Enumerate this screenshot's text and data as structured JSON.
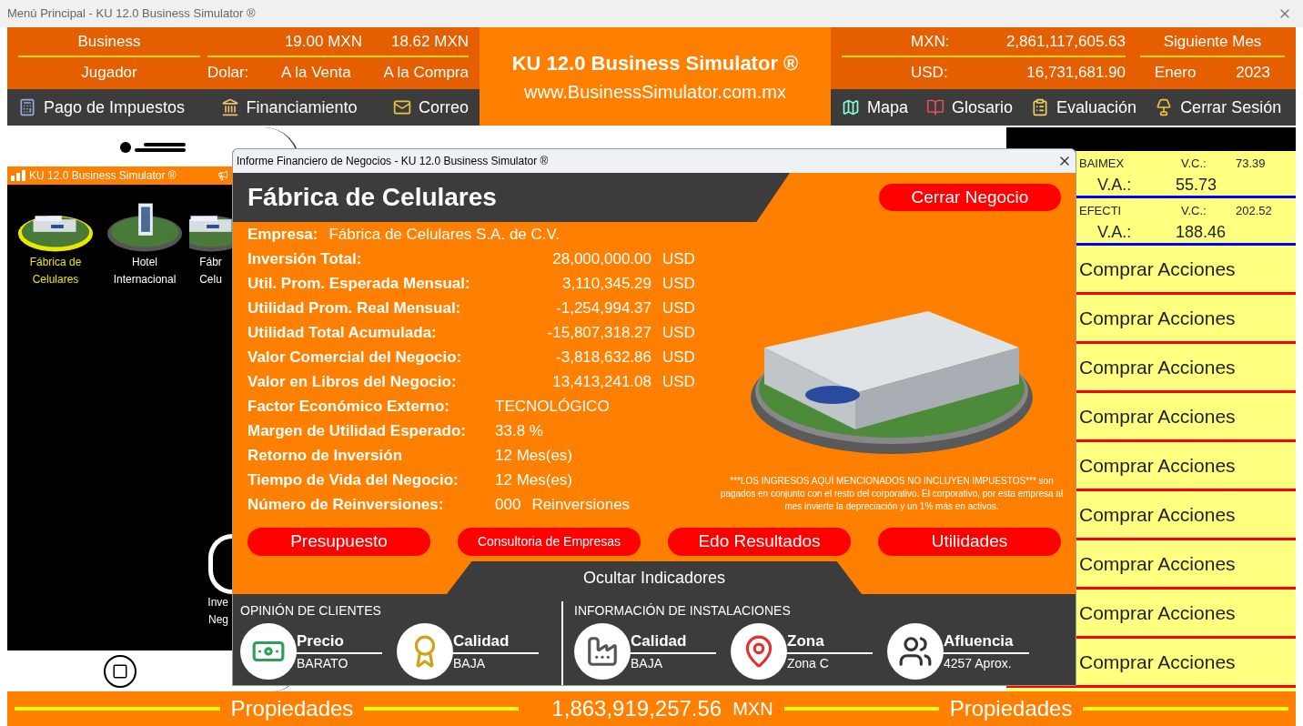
{
  "window": {
    "title": "Menú Principal - KU 12.0 Business Simulator ®"
  },
  "header": {
    "business_label": "Business",
    "player_label": "Jugador",
    "sale_rate": "19.00 MXN",
    "buy_rate": "18.62 MXN",
    "dollar_label": "Dolar:",
    "sale_label": "A la Venta",
    "buy_label": "A la Compra",
    "logo_title": "KU 12.0 Business Simulator ®",
    "logo_url": "www.BusinessSimulator.com.mx",
    "mxn_label": "MXN:",
    "mxn_value": "2,861,117,605.63",
    "usd_label": "USD:",
    "usd_value": "16,731,681.90",
    "next_month": "Siguiente Mes",
    "month": "Enero",
    "year": "2023"
  },
  "toolbar_left": [
    {
      "label": "Pago de Impuestos",
      "kind": "calculator"
    },
    {
      "label": "Financiamiento",
      "kind": "bank"
    },
    {
      "label": "Correo",
      "kind": "mail"
    }
  ],
  "toolbar_right": [
    {
      "label": "Mapa",
      "kind": "map"
    },
    {
      "label": "Glosario",
      "kind": "book"
    },
    {
      "label": "Evaluación",
      "kind": "report"
    },
    {
      "label": "Cerrar Sesión",
      "kind": "lamp"
    }
  ],
  "phone": {
    "title": "KU 12.0 Business Simulator ®",
    "businesses": [
      {
        "lines": [
          "Fábrica de",
          "Celulares"
        ],
        "kind": "factory",
        "selected": true
      },
      {
        "lines": [
          "Hotel",
          "Internacional"
        ],
        "kind": "hotel",
        "selected": false
      },
      {
        "lines": [
          "Fábr",
          "Celu"
        ],
        "kind": "factory",
        "selected": false
      }
    ],
    "shortcut": {
      "lines": [
        "Inve",
        "Neg"
      ]
    }
  },
  "stocks": [
    {
      "name": "BAIMEX",
      "vc_label": "V.C.:",
      "vc": "73.39",
      "va_label": "V.A.:",
      "va": "55.73"
    },
    {
      "name": "EFECTI",
      "vc_label": "V.C.:",
      "vc": "202.52",
      "va_label": "V.A.:",
      "va": "188.46"
    }
  ],
  "buy_buttons": [
    "Comprar Acciones",
    "Comprar Acciones",
    "Comprar Acciones",
    "Comprar Acciones",
    "Comprar Acciones",
    "Comprar Acciones",
    "Comprar Acciones",
    "Comprar Acciones",
    "Comprar Acciones"
  ],
  "dialog": {
    "title": "Informe Financiero de Negocios - KU 12.0 Business Simulator ®",
    "heading": "Fábrica de Celulares",
    "close_business": "Cerrar Negocio",
    "fields": [
      {
        "kind": "inline",
        "label": "Empresa:",
        "value": "Fábrica de Celulares S.A. de C.V."
      },
      {
        "kind": "amount",
        "label": "Inversión Total:",
        "value": "28,000,000.00",
        "unit": "USD"
      },
      {
        "kind": "amount",
        "label": "Util. Prom. Esperada Mensual:",
        "value": "3,110,345.29",
        "unit": "USD"
      },
      {
        "kind": "amount",
        "label": "Utilidad Prom. Real Mensual:",
        "value": "-1,254,994.37",
        "unit": "USD"
      },
      {
        "kind": "amount",
        "label": "Utilidad Total Acumulada:",
        "value": "-15,807,318.27",
        "unit": "USD"
      },
      {
        "kind": "amount",
        "label": "Valor Comercial del Negocio:",
        "value": "-3,818,632.86",
        "unit": "USD"
      },
      {
        "kind": "amount",
        "label": "Valor en Libros del Negocio:",
        "value": "13,413,241.08",
        "unit": "USD"
      },
      {
        "kind": "text",
        "label": "Factor Económico Externo:",
        "value": "TECNOLÓGICO"
      },
      {
        "kind": "text",
        "label": "Margen de Utilidad Esperado:",
        "value": "33.8 %"
      },
      {
        "kind": "text",
        "label": "Retorno de Inversión",
        "value": "12 Mes(es)"
      },
      {
        "kind": "text",
        "label": "Tiempo de Vida del Negocio:",
        "value": "12 Mes(es)"
      },
      {
        "kind": "text",
        "label": "Número de Reinversiones:",
        "value": "000",
        "unit": "Reinversiones"
      }
    ],
    "note": "***LOS INGRESOS AQUÍ MENCIONADOS NO INCLUYEN IMPUESTOS*** son pagados en conjunto con el resto del corporativo. El corporativo, por esta empresa al mes invierte la depreciación y un 1% más en activos.",
    "buttons": [
      {
        "label": "Presupuesto",
        "kind": "large"
      },
      {
        "label": "Consultoria de Empresas",
        "kind": "small"
      },
      {
        "label": "Edo Resultados",
        "kind": "large"
      },
      {
        "label": "Utilidades",
        "kind": "large"
      }
    ],
    "hide_indicators": "Ocultar Indicadores",
    "sections": [
      {
        "title": "OPINIÓN DE CLIENTES",
        "indicators": [
          {
            "title": "Precio",
            "value": "BARATO",
            "kind": "money"
          },
          {
            "title": "Calidad",
            "value": "BAJA",
            "kind": "medal"
          }
        ]
      },
      {
        "title": "INFORMACIÓN DE INSTALACIONES",
        "indicators": [
          {
            "title": "Calidad",
            "value": "BAJA",
            "kind": "factory"
          },
          {
            "title": "Zona",
            "value": "Zona C",
            "kind": "map"
          },
          {
            "title": "Afluencia",
            "value": "4257 Aprox.",
            "kind": "crowd"
          }
        ]
      }
    ]
  },
  "footer": {
    "left_label": "Propiedades",
    "amount": "1,863,919,257.56",
    "currency": "MXN",
    "right_label": "Propiedades"
  }
}
